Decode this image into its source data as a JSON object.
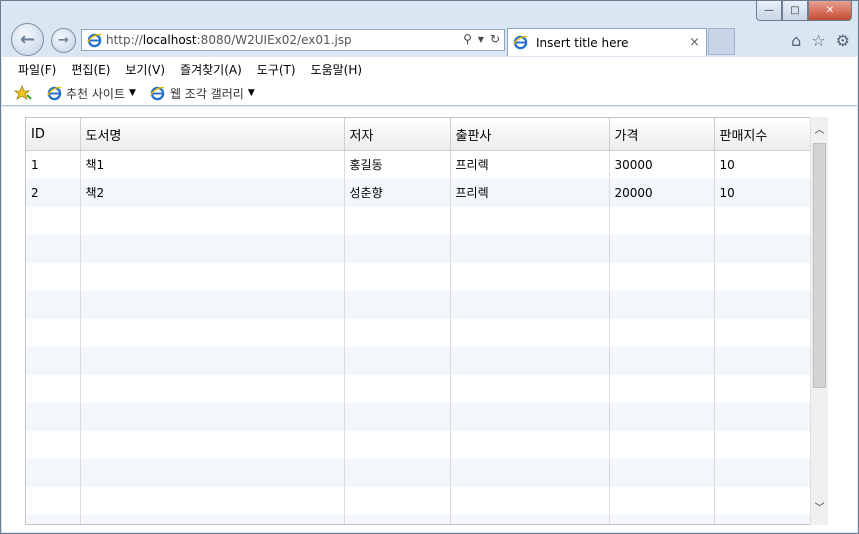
{
  "browser": {
    "url_prefix": "http://",
    "url_host": "localhost",
    "url_rest": ":8080/W2UIEx02/ex01.jsp",
    "tab_title": "Insert title here",
    "tab_close": "×",
    "window_min": "—",
    "window_max": "□",
    "window_close": "✕"
  },
  "menu": [
    "파일(F)",
    "편집(E)",
    "보기(V)",
    "즐겨찾기(A)",
    "도구(T)",
    "도움말(H)"
  ],
  "favorites": {
    "suggested_sites": "추천 사이트",
    "web_slice_gallery": "웹 조각 갤러리"
  },
  "grid": {
    "columns": [
      "ID",
      "도서명",
      "저자",
      "출판사",
      "가격",
      "판매지수"
    ],
    "rows": [
      [
        "1",
        "책1",
        "홍길동",
        "프리렉",
        "30000",
        "10"
      ],
      [
        "2",
        "책2",
        "성춘향",
        "프리렉",
        "20000",
        "10"
      ]
    ]
  }
}
